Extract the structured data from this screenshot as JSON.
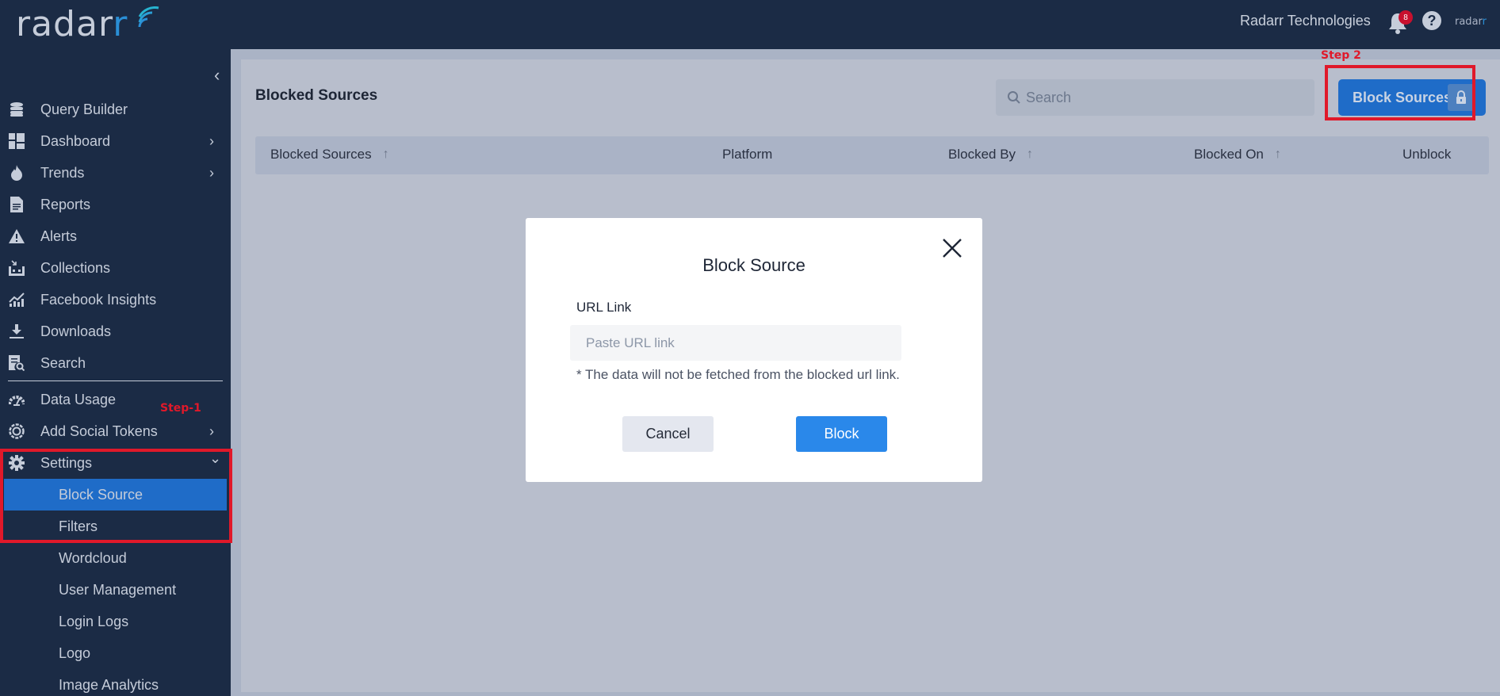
{
  "topbar": {
    "logo_text": "radar",
    "logo_last_letter": "r",
    "org_name": "Radarr Technologies",
    "notifications_count": "8",
    "help_symbol": "?",
    "mini_logo_text": "radar",
    "mini_logo_last_letter": "r"
  },
  "sidebar": {
    "collapse_symbol": "‹",
    "items": [
      {
        "label": "Query Builder",
        "icon": "database-icon",
        "has_chevron": false
      },
      {
        "label": "Dashboard",
        "icon": "dashboard-icon",
        "has_chevron": true
      },
      {
        "label": "Trends",
        "icon": "fire-icon",
        "has_chevron": true
      },
      {
        "label": "Reports",
        "icon": "document-icon",
        "has_chevron": false
      },
      {
        "label": "Alerts",
        "icon": "warning-icon",
        "has_chevron": false
      },
      {
        "label": "Collections",
        "icon": "collections-icon",
        "has_chevron": false
      },
      {
        "label": "Facebook Insights",
        "icon": "chart-line-icon",
        "has_chevron": false
      },
      {
        "label": "Downloads",
        "icon": "download-icon",
        "has_chevron": false
      },
      {
        "label": "Search",
        "icon": "search-doc-icon",
        "has_chevron": false
      },
      {
        "label": "Data Usage",
        "icon": "gauge-icon",
        "has_chevron": false
      },
      {
        "label": "Add Social Tokens",
        "icon": "target-icon",
        "has_chevron": true
      },
      {
        "label": "Settings",
        "icon": "gear-icon",
        "has_chevron": true,
        "expanded": true
      }
    ],
    "settings_subitems": [
      {
        "label": "Block Source",
        "active": true
      },
      {
        "label": "Filters",
        "active": false
      },
      {
        "label": "Wordcloud",
        "active": false
      },
      {
        "label": "User Management",
        "active": false
      },
      {
        "label": "Login Logs",
        "active": false
      },
      {
        "label": "Logo",
        "active": false
      },
      {
        "label": "Image Analytics",
        "active": false
      }
    ],
    "chevron_right": "›",
    "chevron_down": "⌄"
  },
  "annotations": {
    "step1": "Step-1",
    "step2": "Step 2",
    "color": "#e0192a"
  },
  "main": {
    "page_title": "Blocked Sources",
    "search_placeholder": "Search",
    "block_sources_button": "Block Sources",
    "table": {
      "columns": [
        {
          "label": "Blocked Sources",
          "sortable": true
        },
        {
          "label": "Platform",
          "sortable": false
        },
        {
          "label": "Blocked By",
          "sortable": true
        },
        {
          "label": "Blocked On",
          "sortable": true
        },
        {
          "label": "Unblock",
          "sortable": false
        }
      ],
      "sort_symbol": "↑",
      "rows": []
    }
  },
  "modal": {
    "title": "Block Source",
    "url_label": "URL Link",
    "url_value": "",
    "url_placeholder": "Paste URL link",
    "note": "* The data will not be fetched from the blocked url link.",
    "cancel_label": "Cancel",
    "block_label": "Block"
  },
  "colors": {
    "sidebar_bg": "#1b2b45",
    "active_item": "#1f6cc8",
    "primary_button": "#2a88ea",
    "badge": "#c8102e"
  }
}
